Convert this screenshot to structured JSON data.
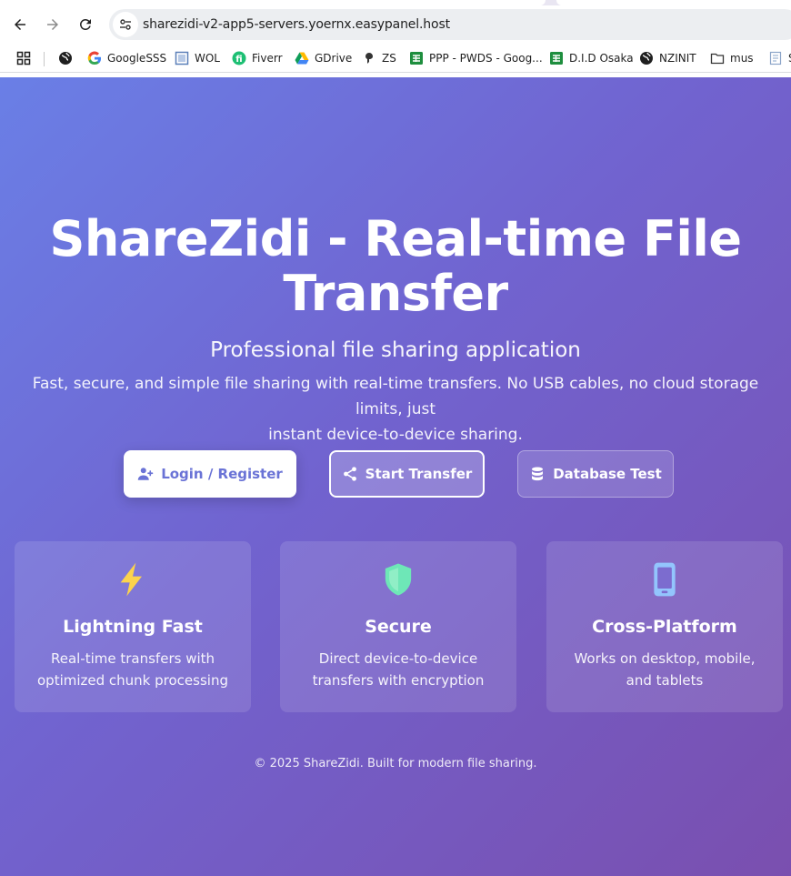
{
  "browser": {
    "url": "sharezidi-v2-app5-servers.yoernx.easypanel.host",
    "bookmarks": [
      {
        "label": "",
        "icon": "apps-grid-icon"
      },
      {
        "label": "",
        "icon": "globe-icon"
      },
      {
        "label": "GoogleSSS",
        "icon": "google-icon"
      },
      {
        "label": "WOL",
        "icon": "page-icon"
      },
      {
        "label": "Fiverr",
        "icon": "fiverr-icon"
      },
      {
        "label": "GDrive",
        "icon": "gdrive-icon"
      },
      {
        "label": "ZS",
        "icon": "zs-icon"
      },
      {
        "label": "PPP - PWDS - Goog...",
        "icon": "sheets-icon"
      },
      {
        "label": "D.I.D Osaka",
        "icon": "sheets-icon"
      },
      {
        "label": "NZINIT",
        "icon": "globe-icon"
      },
      {
        "label": "mus",
        "icon": "folder-icon"
      },
      {
        "label": "S",
        "icon": "doc-icon"
      }
    ]
  },
  "hero": {
    "title_line1": "ShareZidi - Real-time File",
    "title_line2": "Transfer",
    "subtitle": "Professional file sharing application",
    "description_line1": "Fast, secure, and simple file sharing with real-time transfers. No USB cables, no cloud storage limits, just",
    "description_line2": "instant device-to-device sharing."
  },
  "actions": {
    "login": "Login / Register",
    "transfer": "Start Transfer",
    "database": "Database Test"
  },
  "features": [
    {
      "title": "Lightning Fast",
      "text": "Real-time transfers with optimized chunk processing",
      "icon": "lightning-icon",
      "color": "#fcd34d"
    },
    {
      "title": "Secure",
      "text": "Direct device-to-device transfers with encryption",
      "icon": "shield-icon",
      "color": "#6ee7b7"
    },
    {
      "title": "Cross-Platform",
      "text": "Works on desktop, mobile, and tablets",
      "icon": "mobile-icon",
      "color": "#93c5fd"
    }
  ],
  "footer": "© 2025 ShareZidi. Built for modern file sharing."
}
